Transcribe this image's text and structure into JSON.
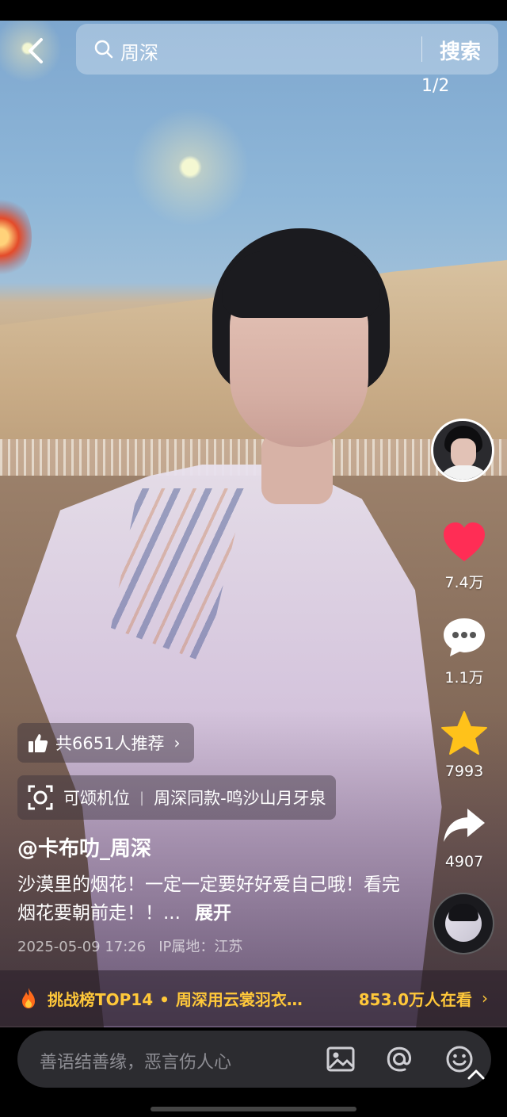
{
  "search": {
    "query": "周深",
    "button_label": "搜索"
  },
  "page_indicator": "1/2",
  "side": {
    "like_count": "7.4万",
    "comment_count": "1.1万",
    "favorite_count": "7993",
    "share_count": "4907"
  },
  "recommend": {
    "label": "共6651人推荐"
  },
  "spot_tag": {
    "left": "可颂机位",
    "right": "周深同款-鸣沙山月牙泉"
  },
  "post": {
    "author": "@卡布叻_周深",
    "description": "沙漠里的烟花！一定一定要好好爱自己哦！看完烟花要朝前走！！...",
    "expand_label": "展开",
    "datetime": "2025-05-09 17:26",
    "ip_location": "IP属地：江苏"
  },
  "challenge": {
    "rank": "挑战榜TOP14",
    "title": "周深用云裳羽衣…",
    "viewers": "853.0万人在看"
  },
  "comment_bar": {
    "placeholder": "善语结善缘，恶言伤人心"
  },
  "colors": {
    "like_red": "#ff2d55",
    "favorite_yellow": "#ffc21a",
    "challenge_gold": "#ffc83a"
  }
}
